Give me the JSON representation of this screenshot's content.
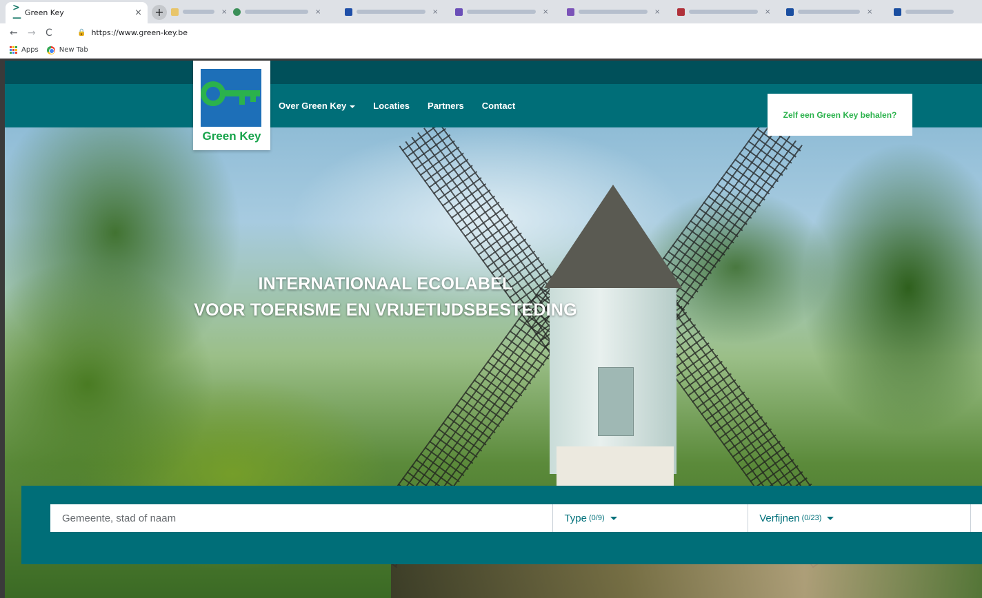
{
  "browser": {
    "active_tab": {
      "title": "Green Key",
      "close": "×",
      "favicon": "green-key-favicon"
    },
    "new_tab": "+",
    "background_tabs": [
      {
        "color": "#e8c56a"
      },
      {
        "color": "#3a8f58"
      },
      {
        "color": "#1f4fa8"
      },
      {
        "color": "#6b4fb8"
      },
      {
        "color": "#7b53b8"
      },
      {
        "color": "#b0313a"
      },
      {
        "color": "#1a4ea0"
      },
      {
        "color": "#1a4ea0"
      }
    ],
    "address_bar": {
      "url": "https://www.green-key.be"
    },
    "nav": {
      "back": "←",
      "forward": "→",
      "reload": "C",
      "lock": "🔒"
    },
    "bookmarks": [
      {
        "label": "Apps",
        "icon": "apps-grid-icon"
      },
      {
        "label": "New Tab",
        "icon": "chrome-icon"
      }
    ]
  },
  "site": {
    "logo_text": "Green Key",
    "menu": [
      {
        "label": "Over Green Key",
        "has_dropdown": true
      },
      {
        "label": "Locaties"
      },
      {
        "label": "Partners"
      },
      {
        "label": "Contact"
      }
    ],
    "cta": "Zelf een Green Key behalen?",
    "hero": {
      "line1": "INTERNATIONAAL ECOLABEL",
      "line2": "VOOR TOERISME EN VRIJETIJDSBESTEDING"
    },
    "search": {
      "placeholder": "Gemeente, stad of naam",
      "type_label": "Type",
      "type_count": "(0/9)",
      "refine_label": "Verfijnen",
      "refine_count": "(0/23)"
    },
    "colors": {
      "primary": "#006e78",
      "topbar": "#00505a",
      "accent_green": "#2bb24c",
      "logo_blue": "#1d6fb8"
    }
  }
}
